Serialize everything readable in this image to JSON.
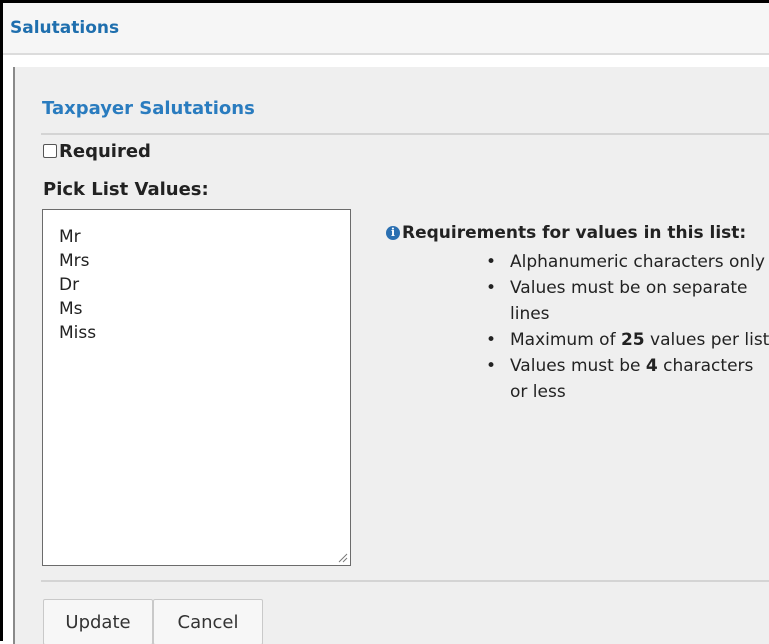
{
  "dialog": {
    "title": "Salutations"
  },
  "section": {
    "title": "Taxpayer Salutations"
  },
  "required": {
    "label": "Required",
    "checked": false
  },
  "pick_list": {
    "label": "Pick List Values:",
    "values": [
      "Mr",
      "Mrs",
      "Dr",
      "Ms",
      "Miss"
    ]
  },
  "requirements": {
    "heading": "Requirements for values in this list:",
    "icon": "info-icon",
    "items": [
      "Alphanumeric characters only",
      "Values must be on separate lines",
      "Maximum of 25 values per list",
      "Values must be 4 characters or less"
    ]
  },
  "buttons": {
    "update": "Update",
    "cancel": "Cancel"
  },
  "colors": {
    "title": "#1f6fae",
    "section_title": "#2a7cbf",
    "info_icon": "#2a6fb1"
  }
}
